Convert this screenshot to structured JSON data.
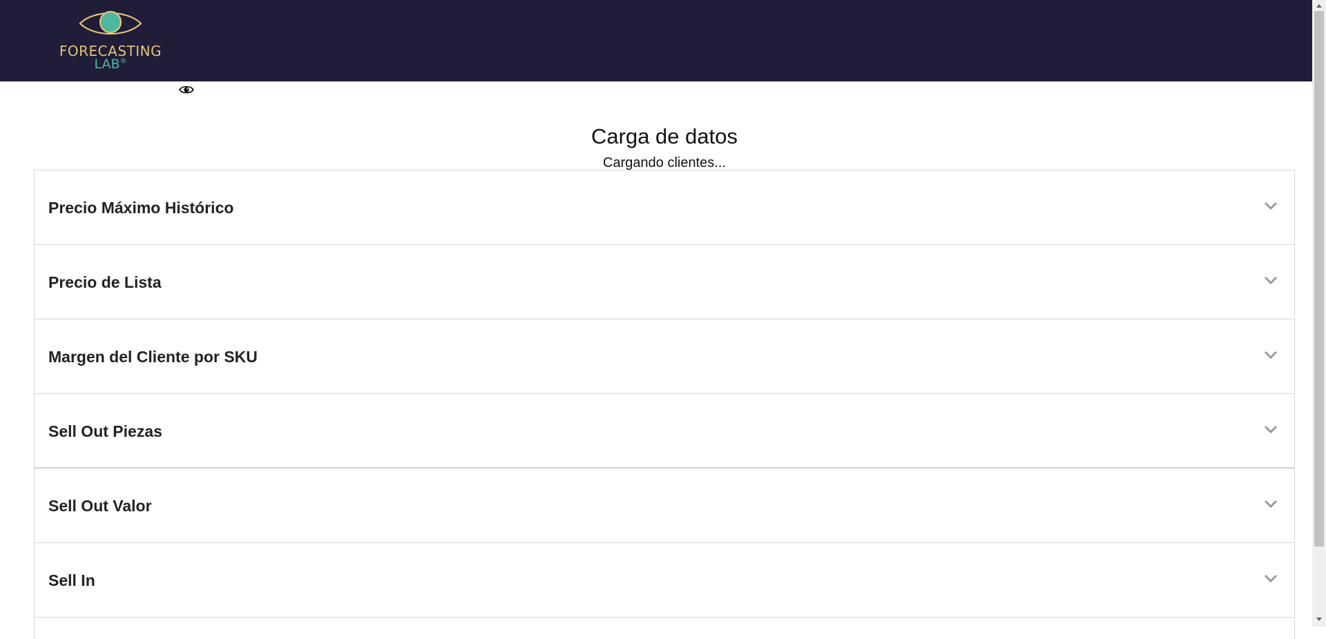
{
  "header": {
    "logo_line1": "FORECASTING",
    "logo_line2": "LAB",
    "logo_mark": "®",
    "background": "#1f1d38",
    "logo_icon": "eye-icon"
  },
  "visibility_toggle_icon": "eye-icon",
  "main": {
    "title": "Carga de datos",
    "status": "Cargando clientes..."
  },
  "accordion": {
    "items": [
      {
        "label": "Precio Máximo Histórico",
        "icon": "chevron-down-icon"
      },
      {
        "label": "Precio de Lista",
        "icon": "chevron-down-icon"
      },
      {
        "label": "Margen del Cliente por SKU",
        "icon": "chevron-down-icon"
      },
      {
        "label": "Sell Out Piezas",
        "icon": "chevron-down-icon"
      },
      {
        "label": "Sell Out Valor",
        "icon": "chevron-down-icon"
      },
      {
        "label": "Sell In",
        "icon": "chevron-down-icon"
      }
    ]
  },
  "colors": {
    "brand_gold": "#e6c27c",
    "brand_teal": "#4bb8a1"
  }
}
